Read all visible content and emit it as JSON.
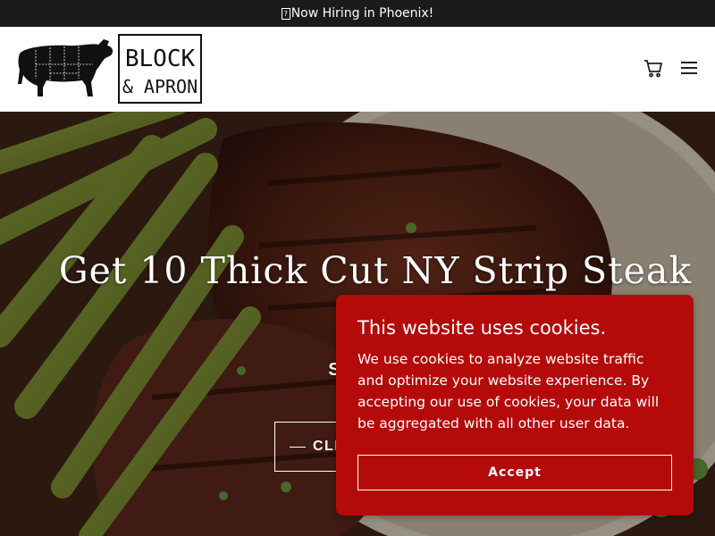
{
  "announcement": {
    "icon": "unknown-glyph-icon",
    "text": "Now Hiring in Phoenix!"
  },
  "header": {
    "logo": {
      "line1": "BLOCK",
      "line2": "& APRON",
      "icon": "cow-butcher-chart-icon"
    },
    "cart_icon": "cart-icon",
    "menu_icon": "hamburger-menu-icon"
  },
  "hero": {
    "title": "Get 10 Thick Cut NY Strip Steak",
    "subtitle": "Satisfy",
    "cta_label": "CLI"
  },
  "cookie": {
    "title": "This website uses cookies.",
    "body": "We use cookies to analyze website traffic and optimize your website experience. By accepting our use of cookies, your data will be aggregated with all other user data.",
    "accept_label": "Accept",
    "background": "#b50a0a"
  }
}
